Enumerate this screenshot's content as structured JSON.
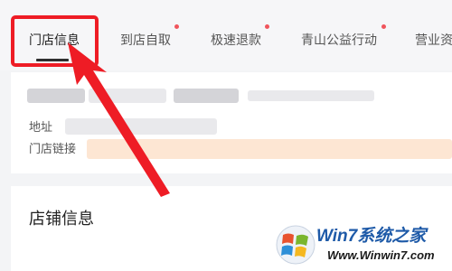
{
  "tabs": [
    {
      "label": "门店信息",
      "active": true,
      "dot": false
    },
    {
      "label": "到店自取",
      "active": false,
      "dot": true
    },
    {
      "label": "极速退款",
      "active": false,
      "dot": true
    },
    {
      "label": "青山公益行动",
      "active": false,
      "dot": true
    },
    {
      "label": "营业资",
      "active": false,
      "dot": false
    }
  ],
  "store_card": {
    "address_label": "地址",
    "link_label": "门店链接"
  },
  "section": {
    "title": "店铺信息"
  },
  "watermark": {
    "main": "Win7系统之家",
    "sub": "Www.Winwin7.com"
  },
  "colors": {
    "annotation_red": "#ee1c25",
    "tab_dot": "#f0545c",
    "blurred_link": "#fde6d3"
  },
  "icons": {
    "watermark_logo": "windows-logo-icon"
  }
}
